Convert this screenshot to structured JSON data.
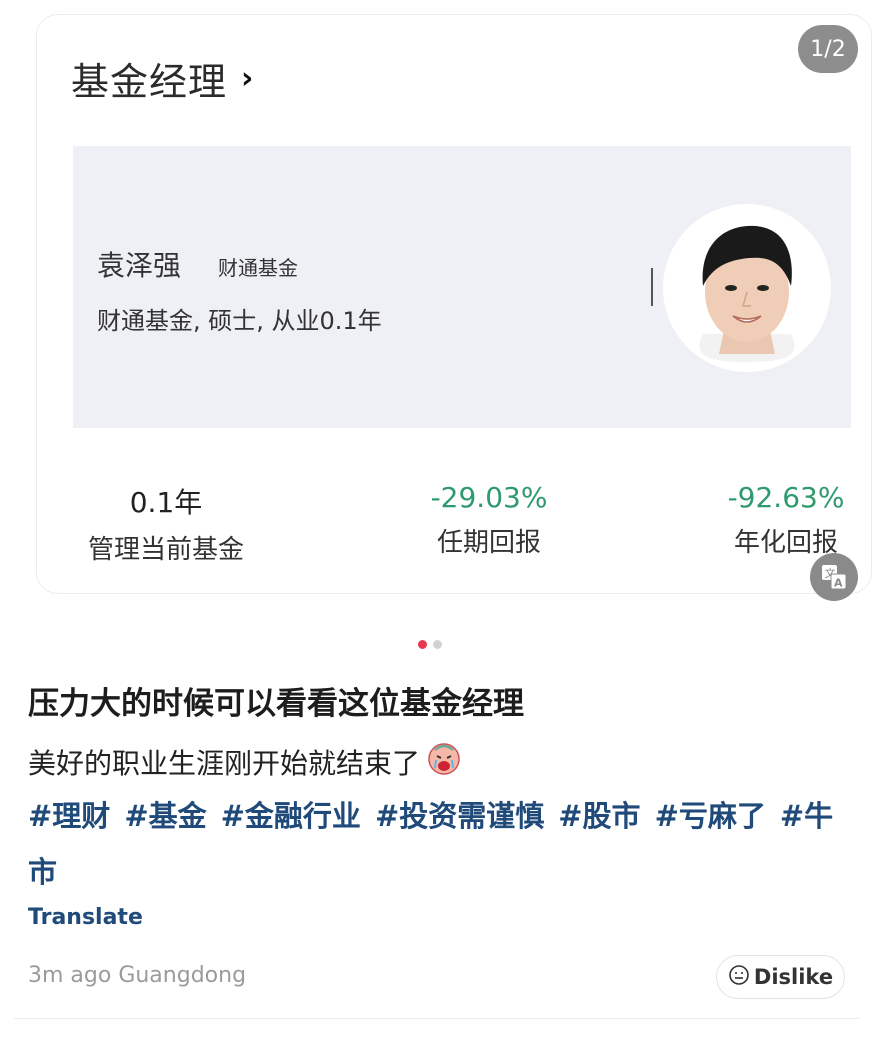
{
  "carousel": {
    "page_indicator": "1/2",
    "card": {
      "title": "基金经理",
      "manager_name": "袁泽强",
      "manager_company": "财通基金",
      "manager_meta": "财通基金, 硕士, 从业0.1年",
      "stats": [
        {
          "value": "0.1年",
          "label": "管理当前基金"
        },
        {
          "value": "-29.03%",
          "label": "任期回报"
        },
        {
          "value": "-92.63%",
          "label": "年化回报"
        }
      ]
    },
    "dots_total": 2,
    "dots_active": 1
  },
  "post": {
    "title": "压力大的时候可以看看这位基金经理",
    "body": "美好的职业生涯刚开始就结束了",
    "tags": [
      "#理财",
      "#基金",
      "#金融行业",
      "#投资需谨慎",
      "#股市",
      "#亏麻了",
      "#牛市"
    ],
    "translate_label": "Translate",
    "meta": "3m ago Guangdong",
    "dislike_label": "Dislike"
  },
  "colors": {
    "tag_blue": "#1f4a7a",
    "return_green": "#2f9a6e",
    "dot_active": "#e8384f"
  },
  "icons": [
    "chevron-right-icon",
    "translate-icon",
    "crying-emoji-icon",
    "neutral-face-icon"
  ]
}
